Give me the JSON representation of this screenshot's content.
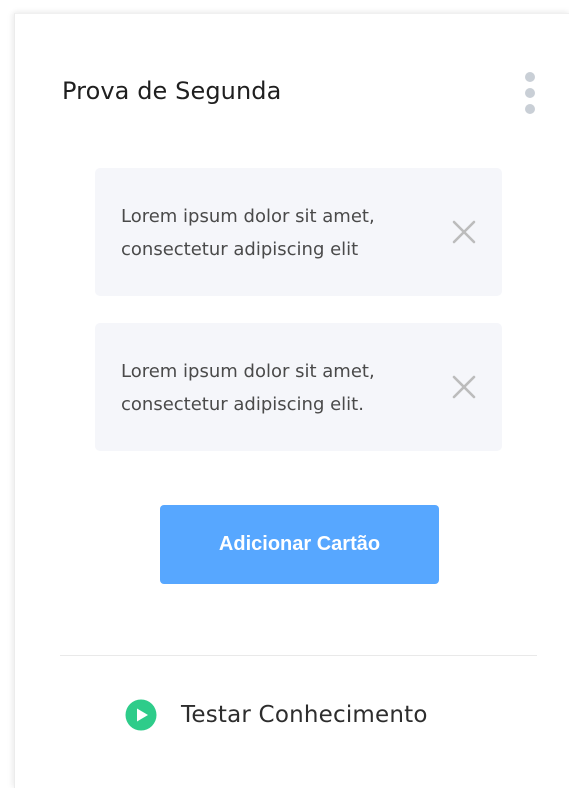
{
  "deck": {
    "title": "Prova de Segunda",
    "menu_icon": "more-vertical-icon"
  },
  "cards": [
    {
      "text": "Lorem ipsum dolor sit amet, consectetur adipiscing elit",
      "remove_icon": "close-icon"
    },
    {
      "text": "Lorem ipsum dolor sit amet, consectetur adipiscing elit.",
      "remove_icon": "close-icon"
    }
  ],
  "actions": {
    "add_card_label": "Adicionar Cartão",
    "test_label": "Testar Conhecimento",
    "test_icon": "play-circle-icon"
  },
  "colors": {
    "primary_button": "#57a7ff",
    "play_accent": "#2ecc8a",
    "card_background": "#f5f6fa",
    "menu_dots": "#c9cfd6"
  }
}
